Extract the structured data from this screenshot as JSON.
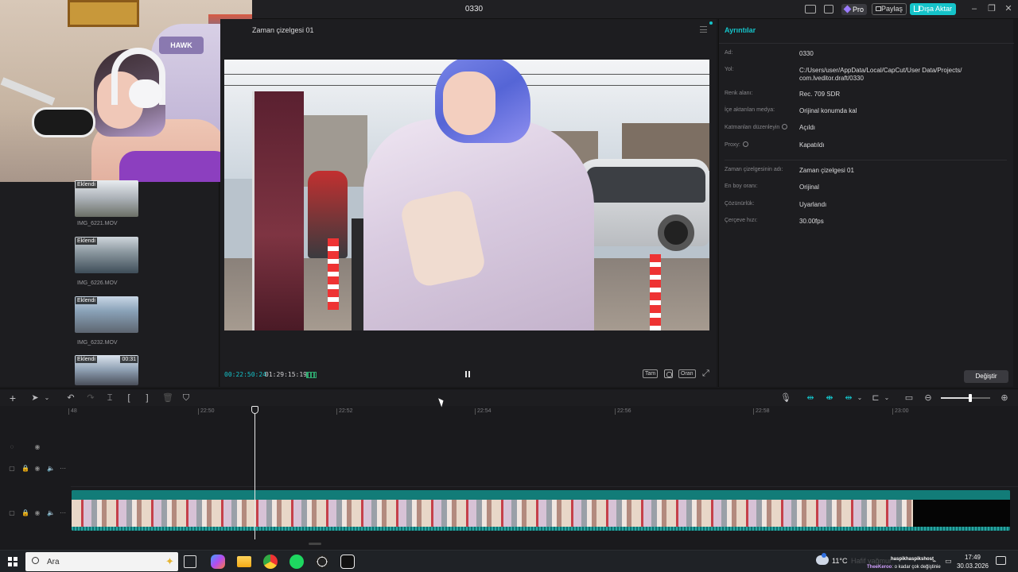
{
  "window": {
    "title": "0330"
  },
  "header": {
    "pro_label": "Pro",
    "share_label": "Paylaş",
    "export_label": "Dışa Aktar"
  },
  "webcam": {
    "chair_brand": "HAWK"
  },
  "media": {
    "items": [
      {
        "badge": "Eklendi",
        "duration": "",
        "name": "IMG_6221.MOV"
      },
      {
        "badge": "Eklendi",
        "duration": "",
        "name": "IMG_6226.MOV"
      },
      {
        "badge": "Eklendi",
        "duration": "",
        "name": "IMG_6232.MOV"
      },
      {
        "badge": "Eklendi",
        "duration": "00:31",
        "name": ""
      }
    ]
  },
  "player": {
    "title": "Zaman çizelgesi 01",
    "current_time": "00:22:50:24",
    "total_time": "01:29:15:19",
    "btn_full": "Tam",
    "btn_ratio": "Oran"
  },
  "details": {
    "title": "Ayrıntılar",
    "rows": [
      {
        "key": "Ad:",
        "value": "0330"
      },
      {
        "key": "Yol:",
        "value": "C:/Users/user/AppData/Local/CapCut/User Data/Projects/\ncom.lveditor.draft/0330"
      },
      {
        "key": "Renk alanı:",
        "value": "Rec. 709 SDR"
      },
      {
        "key": "İçe aktarılan medya:",
        "value": "Orijinal konumda kal"
      },
      {
        "key": "Katmanları düzenleyin",
        "value": "Açıldı"
      },
      {
        "key": "Proxy:",
        "value": "Kapatıldı"
      },
      {
        "key": "Zaman çizelgesinin adı:",
        "value": "Zaman çizelgesi 01"
      },
      {
        "key": "En boy oranı:",
        "value": "Orijinal"
      },
      {
        "key": "Çözünürlük:",
        "value": "Uyarlandı"
      },
      {
        "key": "Çerçeve hızı:",
        "value": "30.00fps"
      }
    ],
    "change_label": "Değiştir"
  },
  "timeline": {
    "ruler": [
      "48",
      "22:50",
      "22:52",
      "22:54",
      "22:56",
      "22:58",
      "23:00"
    ],
    "zoom_fraction": 0.6
  },
  "taskbar": {
    "search_placeholder": "Ara",
    "temperature": "11°C",
    "weather": "Hafif yağmur",
    "notif_user": "haspikhaspikshost",
    "notif_text_user": "TheeKeroo",
    "notif_text": ": o kadar çok değiştinie",
    "time": "17:49",
    "date": "30.03.2026"
  }
}
